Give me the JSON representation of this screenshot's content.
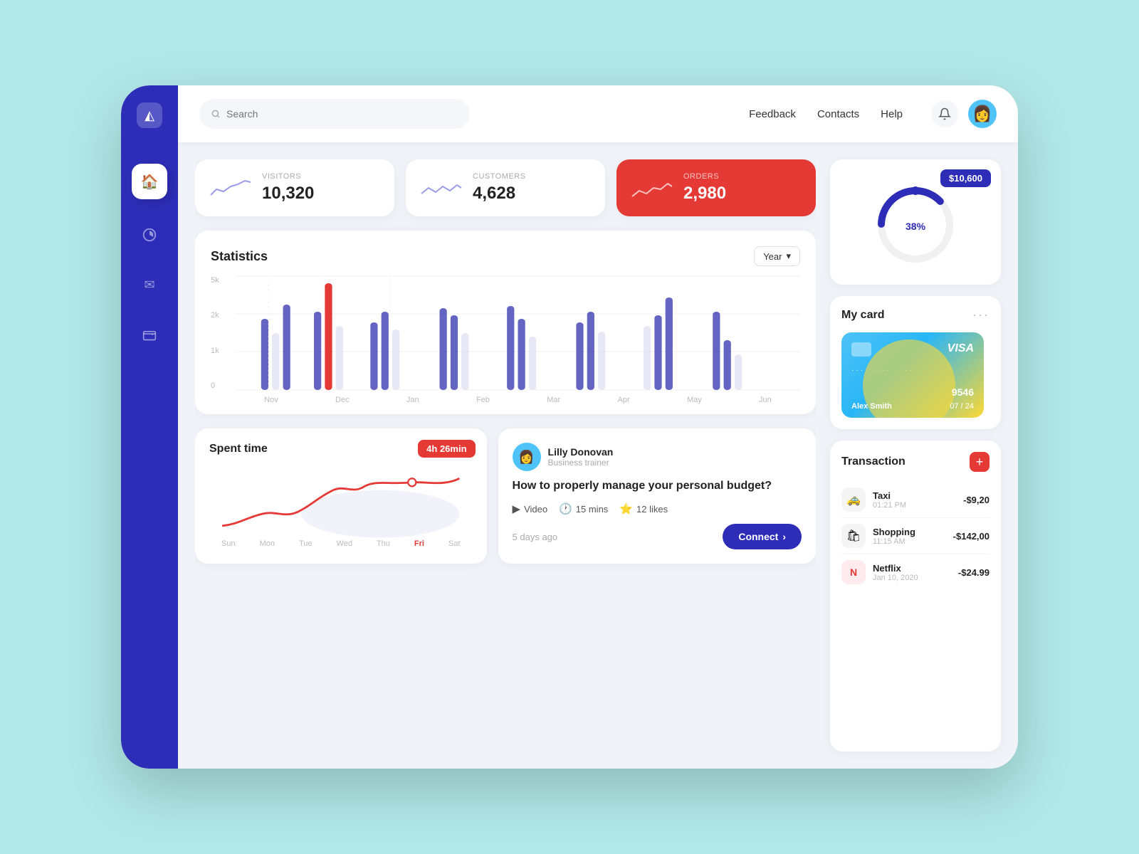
{
  "header": {
    "search_placeholder": "Search",
    "nav": [
      {
        "label": "Feedback"
      },
      {
        "label": "Contacts"
      },
      {
        "label": "Help"
      }
    ]
  },
  "stats": [
    {
      "label": "VISITORS",
      "value": "10,320",
      "type": "visitors"
    },
    {
      "label": "CUSTOMERS",
      "value": "4,628",
      "type": "customers"
    },
    {
      "label": "ORDERS",
      "value": "2,980",
      "type": "orders"
    }
  ],
  "statistics": {
    "title": "Statistics",
    "year_label": "Year",
    "y_labels": [
      "5k",
      "2k",
      "1k",
      "0"
    ],
    "x_labels": [
      "Nov",
      "Dec",
      "Jan",
      "Feb",
      "Mar",
      "Apr",
      "May",
      "Jun"
    ]
  },
  "spent_time": {
    "title": "Spent time",
    "badge": "4h 26min",
    "days": [
      "Sun",
      "Mon",
      "Tue",
      "Wed",
      "Thu",
      "Fri",
      "Sat"
    ],
    "active_day": "Fri"
  },
  "article": {
    "author_name": "Lilly Donovan",
    "author_role": "Business trainer",
    "title": "How to properly manage your personal budget?",
    "video_label": "Video",
    "duration": "15 mins",
    "likes": "12 likes",
    "date": "5 days ago",
    "connect_label": "Connect"
  },
  "donut": {
    "percentage": "38",
    "percent_sign": "%",
    "amount": "$10,600"
  },
  "my_card": {
    "title": "My card",
    "brand": "VISA",
    "number_dots": "····  ····  ····",
    "number": "9546",
    "name": "Alex Smith",
    "expiry": "07 / 24"
  },
  "transactions": {
    "title": "Transaction",
    "items": [
      {
        "name": "Taxi",
        "time": "01:21 PM",
        "amount": "-$9,20",
        "icon": "🚕"
      },
      {
        "name": "Shopping",
        "time": "11:15 AM",
        "amount": "-$142,00",
        "icon": "🛍"
      },
      {
        "name": "Netflix",
        "time": "Jan 10, 2020",
        "amount": "-$24.99",
        "icon": "N"
      }
    ]
  }
}
